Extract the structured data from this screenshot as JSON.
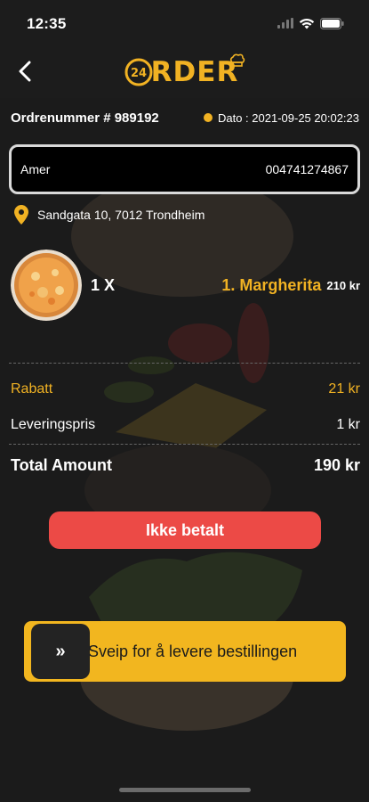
{
  "status_bar": {
    "time": "12:35"
  },
  "header": {
    "logo_badge": "24",
    "logo_text": "RDER"
  },
  "order": {
    "number_label": "Ordrenummer # 989192",
    "date_label": "Dato : 2021-09-25 20:02:23"
  },
  "customer": {
    "name": "Amer",
    "phone": "004741274867",
    "address": "Sandgata 10, 7012 Trondheim"
  },
  "items": [
    {
      "qty": "1 X",
      "name": "1. Margherita",
      "price": "210 kr"
    }
  ],
  "summary": {
    "discount_label": "Rabatt",
    "discount_value": "21 kr",
    "delivery_label": "Leveringspris",
    "delivery_value": "1 kr",
    "total_label": "Total Amount",
    "total_value": "190 kr"
  },
  "payment_status_button": "Ikke betalt",
  "swipe": {
    "handle": "»",
    "label": "Sveip for å levere bestillingen"
  },
  "colors": {
    "accent": "#f1b223",
    "unpaid": "#ec4a46",
    "background": "#1c1c1c"
  },
  "icons": [
    "back-chevron-icon",
    "location-pin-icon",
    "wifi-icon",
    "battery-icon",
    "signal-icon"
  ]
}
